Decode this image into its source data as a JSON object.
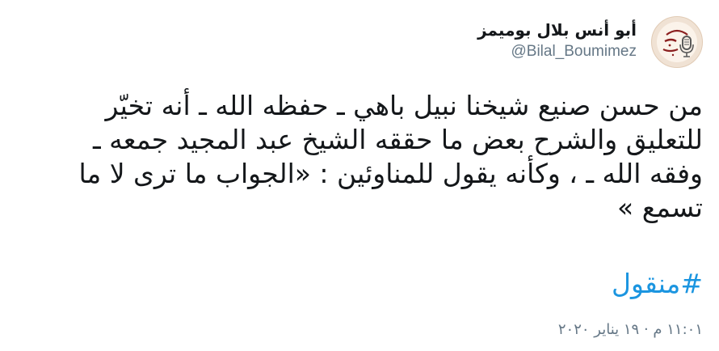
{
  "author": {
    "name": "أبو أنس بلال بوميمز",
    "handle": "@Bilal_Boumimez",
    "avatar_icon": "microphone-logo-icon",
    "avatar_text": "أبو أنس بلال بوميمز"
  },
  "tweet": {
    "text": "من حسن صنيع شيخنا نبيل باهي ـ حفظه الله ـ أنه تخيّر للتعليق والشرح بعض ما حققه الشيخ عبد المجيد جمعه ـ وفقه الله ـ ، وكأنه يقول للمناوئين : «الجواب ما ترى لا ما تسمع »",
    "hashtag": "#منقول",
    "timestamp": "١١:٠١ م · ١٩ يناير ٢٠٢٠"
  },
  "colors": {
    "text": "#14171a",
    "secondary": "#657786",
    "link": "#1b95e0",
    "avatar_accent": "#8b1f1f"
  }
}
